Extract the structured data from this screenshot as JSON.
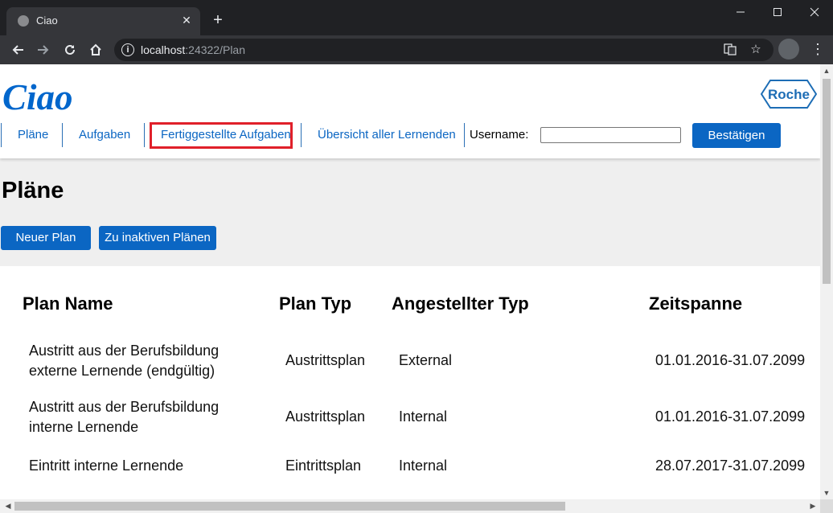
{
  "browser": {
    "tab_title": "Ciao",
    "tab_close": "✕",
    "new_tab": "+",
    "url_host": "localhost",
    "url_rest": ":24322/Plan",
    "icons": [
      "back-icon",
      "forward-icon",
      "reload-icon",
      "home-icon",
      "info-icon",
      "translate-icon",
      "star-icon",
      "profile-icon",
      "menu-icon"
    ]
  },
  "header": {
    "logo": "Ciao",
    "brand": "Roche",
    "nav": [
      "Pläne",
      "Aufgaben",
      "Fertiggestellte Aufgaben",
      "Übersicht aller Lernenden"
    ],
    "username_label": "Username:",
    "username_value": "",
    "confirm_label": "Bestätigen"
  },
  "main": {
    "title": "Pläne",
    "new_plan_label": "Neuer Plan",
    "inactive_label": "Zu inaktiven Plänen"
  },
  "table": {
    "headers": [
      "Plan Name",
      "Plan Typ",
      "Angestellter Typ",
      "Zeitspanne"
    ],
    "rows": [
      {
        "name_line1": "Austritt aus der Berufsbildung",
        "name_line2": "externe Lernende (endgültig)",
        "type": "Austrittsplan",
        "employee_type": "External",
        "period": "01.01.2016-31.07.2099"
      },
      {
        "name_line1": "Austritt aus der Berufsbildung",
        "name_line2": "interne Lernende",
        "type": "Austrittsplan",
        "employee_type": "Internal",
        "period": "01.01.2016-31.07.2099"
      },
      {
        "name_line1": "Eintritt interne Lernende",
        "name_line2": "",
        "type": "Eintrittsplan",
        "employee_type": "Internal",
        "period": "28.07.2017-31.07.2099"
      }
    ]
  },
  "colors": {
    "accent": "#0b66c3",
    "highlight": "#e0202a",
    "logo": "#0066cc"
  }
}
